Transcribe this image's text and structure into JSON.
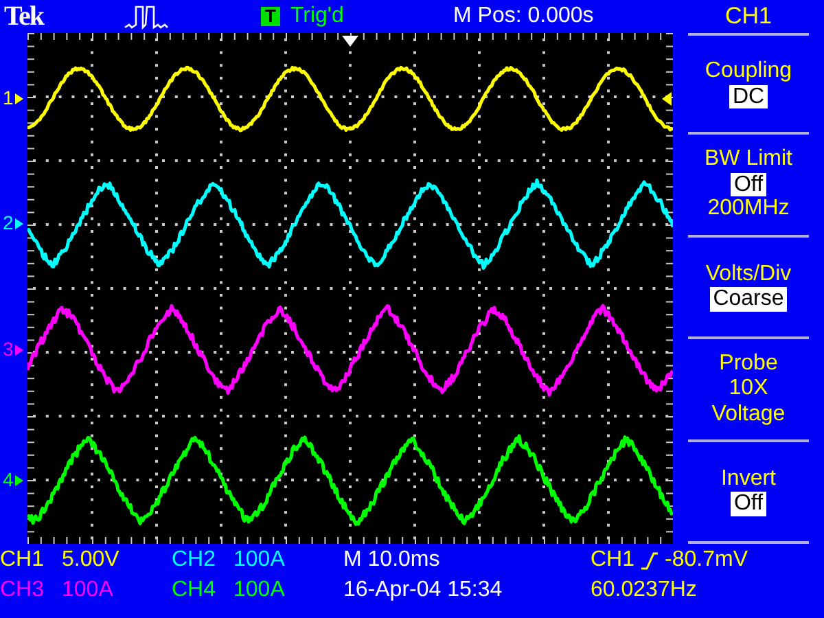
{
  "header": {
    "brand": "Tek",
    "trigger_box": "T",
    "trigger_status": "Trig'd",
    "position": "M Pos: 0.000s"
  },
  "menu": {
    "title": "CH1",
    "items": [
      {
        "kind": "option",
        "label": "Coupling",
        "value": "DC"
      },
      {
        "kind": "option",
        "label": "BW Limit",
        "value": "Off",
        "note": "200MHz"
      },
      {
        "kind": "option",
        "label": "Volts/Div",
        "value": "Coarse"
      },
      {
        "kind": "info",
        "label": "Probe",
        "lines": [
          "10X",
          "Voltage"
        ]
      },
      {
        "kind": "option",
        "label": "Invert",
        "value": "Off"
      }
    ]
  },
  "traces": [
    {
      "marker": "1",
      "color": "#ffff00"
    },
    {
      "marker": "2",
      "color": "#00ffff"
    },
    {
      "marker": "3",
      "color": "#ff00ff"
    },
    {
      "marker": "4",
      "color": "#00ff00"
    }
  ],
  "readouts": [
    [
      {
        "kind": "text",
        "text": "CH1",
        "color": "#ffff00"
      },
      {
        "kind": "text",
        "text": "5.00V",
        "color": "#ffff00"
      },
      {
        "kind": "text",
        "text": "CH2",
        "color": "#00ffff"
      },
      {
        "kind": "text",
        "text": "100A",
        "color": "#00ffff"
      },
      {
        "kind": "text",
        "text": "M 10.0ms",
        "color": "#ffffff"
      },
      {
        "kind": "trigger",
        "source": "CH1",
        "level": "-80.7mV",
        "color": "#ffff00"
      }
    ],
    [
      {
        "kind": "text",
        "text": "CH3",
        "color": "#ff00ff"
      },
      {
        "kind": "text",
        "text": "100A",
        "color": "#ff00ff"
      },
      {
        "kind": "text",
        "text": "CH4",
        "color": "#00ff00"
      },
      {
        "kind": "text",
        "text": "100A",
        "color": "#00ff00"
      },
      {
        "kind": "text",
        "text": "16-Apr-04 15:34",
        "color": "#ffffff"
      },
      {
        "kind": "text",
        "text": "60.0237Hz",
        "color": "#ffff00"
      }
    ]
  ]
}
